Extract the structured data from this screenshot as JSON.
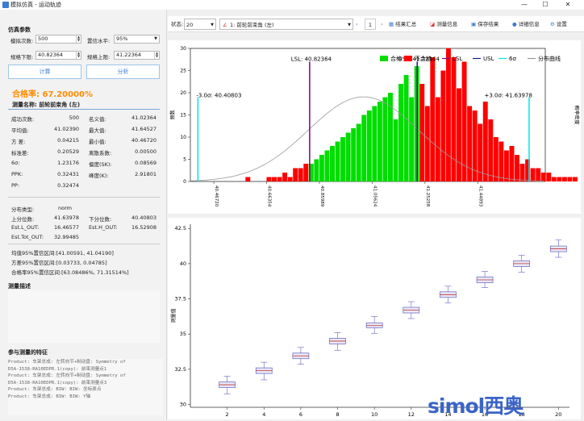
{
  "window": {
    "title": "模拟仿真 - 运动轨迹",
    "minimize": "—",
    "maximize": "☐",
    "close": "✕"
  },
  "left": {
    "section_sim": "仿真参数",
    "sim_count_label": "模拟次数:",
    "sim_count_value": "500",
    "conf_label": "置信水平:",
    "conf_value": "95%",
    "lsl_label": "规格下限:",
    "lsl_value": "40.82364",
    "usl_label": "规格上限:",
    "usl_value": "41.22364",
    "calc_button": "计算",
    "analyze_button": "分析",
    "pass_rate": "合格率: 67.20000%",
    "measure_name": "测量名称: 前轮前束角 (左)",
    "stats": [
      {
        "l1": "成功次数:",
        "v1": "500",
        "l2": "名义值:",
        "v2": "41.02364"
      },
      {
        "l1": "平均值:",
        "v1": "41.02390",
        "l2": "最大值:",
        "v2": "41.64527"
      },
      {
        "l1": "方 差:",
        "v1": "0.04215",
        "l2": "最小值:",
        "v2": "40.46720"
      },
      {
        "l1": "标准差:",
        "v1": "0.20529",
        "l2": "离散系数:",
        "v2": "0.00500"
      },
      {
        "l1": "6σ:",
        "v1": "1.23176",
        "l2": "偏度(SK):",
        "v2": "0.08569"
      },
      {
        "l1": "PPK:",
        "v1": "0.32431",
        "l2": "峰度(K):",
        "v2": "2.91801"
      },
      {
        "l1": "PP:",
        "v1": "0.32474",
        "l2": "",
        "v2": ""
      }
    ],
    "dist_label": "分布类型:",
    "dist_value": "norm",
    "up_pct_label": "上分位数:",
    "up_pct_value": "41.63978",
    "down_pct_label": "下分位数:",
    "down_pct_value": "40.40803",
    "lout_label": "Est.L_OUT:",
    "lout_value": "16.46577",
    "hout_label": "Est.H_OUT:",
    "hout_value": "16.52908",
    "tout_label": "Est.Tot_OUT:",
    "tout_value": "32.99485",
    "ci_mean": "均值95%置信区间:[41.00591, 41.04190]",
    "ci_var": "方差95%置信区间:[0.03733, 0.04785]",
    "ci_pass": "合格率95%置信区间:[63.08486%, 71.31514%]",
    "section_desc": "测量描述",
    "section_feat": "参与测量的特征",
    "features": [
      "Product: 车架总成: 左转向节+制动盘: Symmetry of",
      "D5A-1538-RA10EDPR.1(copy): 前束测量点1",
      "Product: 车架总成: 左转向节+制动盘: Symmetry of",
      "D5A-1538-RA10EDPR.1(copy): 前束测量点3",
      "Product: 车架总成: BIW: BIW: 坐标原点",
      "Product: 车架总成: BIW: BIW: Y轴"
    ]
  },
  "toolbar": {
    "state_label": "状态:",
    "state_value": "20",
    "measure_select": "1: 前轮前束角 (左)",
    "page": "1",
    "results_summary": "结果汇总",
    "measure_info": "测量信息",
    "save_results": "保存结果",
    "detail_info": "详细信息",
    "settings": "设置"
  },
  "colors": {
    "pass": "#00dd00",
    "fail": "#ff0000",
    "lsl": "#800080",
    "usl": "#1a1a8c",
    "sigma": "#00e5ee",
    "curve": "#999999",
    "box": "#6060c0"
  },
  "chart_data": [
    {
      "type": "bar",
      "legend": [
        "合格",
        "不合格",
        "LSL",
        "USL",
        "6σ",
        "分布曲线"
      ],
      "ylabel": "频数",
      "ylabel_right": "概率密度",
      "ylim": [
        0,
        30
      ],
      "yticks": [
        0,
        5,
        10,
        15,
        20,
        25,
        30
      ],
      "xlim": [
        40.38,
        41.7
      ],
      "xticks": [
        "40.46720",
        "40.66354",
        "40.85989",
        "41.05624",
        "41.25258",
        "41.44893"
      ],
      "xtick_values": [
        40.4672,
        40.66354,
        40.85989,
        41.05624,
        41.25258,
        41.44893
      ],
      "lsl": 40.82364,
      "usl": 41.22364,
      "minus3sigma": 40.40803,
      "plus3sigma": 41.63978,
      "lsl_label": "LSL: 40.82364",
      "usl_label": "USL: 41.22364",
      "m3s_label": "-3.0σ: 40.40803",
      "p3s_label": "+3.0σ: 41.63978",
      "bin_start": 40.4672,
      "bin_width": 0.01963,
      "counts": [
        0,
        0,
        0,
        0,
        0,
        0,
        1,
        0,
        0,
        0,
        1,
        1,
        1,
        2,
        1,
        3,
        3,
        4,
        4,
        5,
        6,
        7,
        8,
        9,
        10,
        11,
        12,
        13,
        15,
        16,
        17,
        18,
        19,
        20,
        14,
        22,
        24,
        19,
        26,
        22,
        17,
        28,
        19,
        25,
        30,
        28,
        21,
        27,
        17,
        16,
        13,
        18,
        14,
        10,
        9,
        7,
        8,
        6,
        4,
        5,
        3,
        3,
        2,
        2,
        1,
        1,
        1,
        1,
        1,
        0,
        0,
        0,
        0,
        0,
        1,
        0
      ]
    },
    {
      "type": "box",
      "ylabel": "测量值",
      "ylim": [
        29.8,
        42.8
      ],
      "yticks": [
        30,
        32.5,
        35,
        37.5,
        40,
        42.5
      ],
      "xticks": [
        2,
        4,
        6,
        8,
        10,
        12,
        14,
        16,
        18,
        20
      ],
      "xlim": [
        0,
        20.6
      ],
      "boxes": [
        {
          "x": 2,
          "min": 30.75,
          "q1": 31.2,
          "med": 31.4,
          "q3": 31.6,
          "max": 32.0
        },
        {
          "x": 4,
          "min": 31.75,
          "q1": 32.2,
          "med": 32.4,
          "q3": 32.6,
          "max": 33.0
        },
        {
          "x": 6,
          "min": 32.85,
          "q1": 33.25,
          "med": 33.45,
          "q3": 33.65,
          "max": 34.05
        },
        {
          "x": 8,
          "min": 33.85,
          "q1": 34.3,
          "med": 34.5,
          "q3": 34.7,
          "max": 35.1
        },
        {
          "x": 10,
          "min": 35.05,
          "q1": 35.45,
          "med": 35.6,
          "q3": 35.8,
          "max": 36.25
        },
        {
          "x": 12,
          "min": 36.1,
          "q1": 36.5,
          "med": 36.7,
          "q3": 36.9,
          "max": 37.3
        },
        {
          "x": 14,
          "min": 37.2,
          "q1": 37.6,
          "med": 37.8,
          "q3": 38.0,
          "max": 38.4
        },
        {
          "x": 16,
          "min": 38.3,
          "q1": 38.65,
          "med": 38.85,
          "q3": 39.05,
          "max": 39.45
        },
        {
          "x": 18,
          "min": 39.4,
          "q1": 39.8,
          "med": 40.0,
          "q3": 40.2,
          "max": 40.6
        },
        {
          "x": 20,
          "min": 40.45,
          "q1": 40.85,
          "med": 41.05,
          "q3": 41.25,
          "max": 41.7
        }
      ]
    }
  ]
}
